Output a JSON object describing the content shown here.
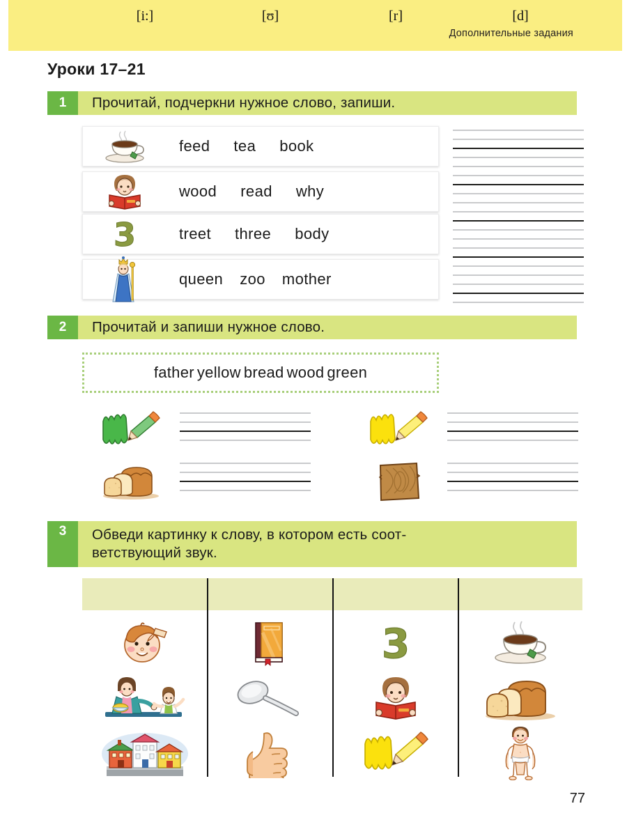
{
  "header": {
    "band_text": "Дополнительные задания",
    "band_color": "#faee82"
  },
  "lesson_title": "Уроки 17–21",
  "page_number": "77",
  "accent": {
    "badge_green": "#6bb745",
    "band_green": "#d9e581",
    "table_head": "#e9ebba",
    "dotted_border": "#a8cf7a"
  },
  "tasks": [
    {
      "number": "1",
      "text": "Прочитай, подчеркни нужное слово, запиши."
    },
    {
      "number": "2",
      "text": "Прочитай и запиши нужное слово."
    },
    {
      "number": "3",
      "text": "Обведи картинку к слову, в котором есть соот-\nветствующий звук."
    },
    {
      "number": "3",
      "line1": "Обведи  картинку  к  слову,  в  котором  есть  соот-",
      "line2": "ветствующий звук."
    }
  ],
  "exercise1": {
    "rows": [
      {
        "icon": "teacup-icon",
        "words": [
          "feed",
          "tea",
          "book"
        ]
      },
      {
        "icon": "girl-reading-icon",
        "words": [
          "wood",
          "read",
          "why"
        ]
      },
      {
        "icon": "number-three-icon",
        "words": [
          "treet",
          "three",
          "body"
        ]
      },
      {
        "icon": "queen-icon",
        "words": [
          "queen",
          "zoo",
          "mother"
        ]
      }
    ]
  },
  "exercise2": {
    "wordbank": [
      "father",
      "yellow",
      "bread",
      "wood",
      "green"
    ],
    "items": [
      {
        "icon": "green-scribble-pencil-icon",
        "position": "left-top"
      },
      {
        "icon": "yellow-scribble-pencil-icon",
        "position": "right-top"
      },
      {
        "icon": "bread-loaf-icon",
        "position": "left-bottom"
      },
      {
        "icon": "wood-plank-icon",
        "position": "right-bottom"
      }
    ]
  },
  "exercise3": {
    "columns": [
      {
        "sound": "[i:]",
        "pictures": [
          "head-face-icon",
          "mother-feeding-child-icon",
          "street-houses-icon"
        ]
      },
      {
        "sound": "[ʊ]",
        "pictures": [
          "book-icon",
          "spoon-icon",
          "thumbs-up-icon"
        ]
      },
      {
        "sound": "[r]",
        "pictures": [
          "number-three-icon",
          "girl-reading-icon",
          "yellow-scribble-pencil-icon"
        ]
      },
      {
        "sound": "[d]",
        "pictures": [
          "teacup-icon",
          "bread-loaf-icon",
          "body-boy-icon"
        ]
      }
    ]
  }
}
